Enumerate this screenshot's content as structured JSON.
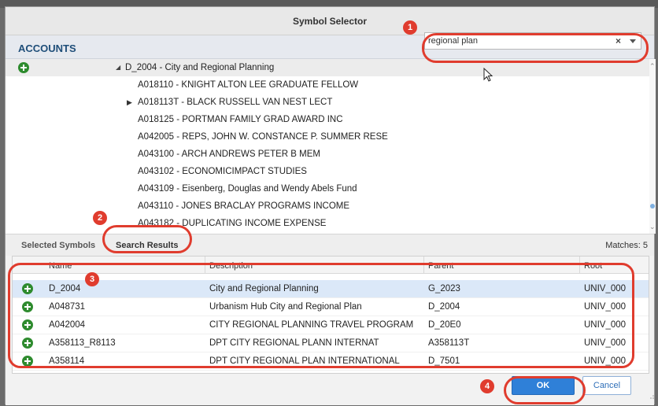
{
  "dialog": {
    "title": "Symbol Selector"
  },
  "accounts": {
    "label": "ACCOUNTS",
    "search": {
      "value": "regional plan",
      "clear": "×"
    }
  },
  "tree": {
    "root": {
      "label": "D_2004 - City and Regional Planning",
      "expanded": true
    },
    "items": [
      {
        "label": "A018110 - KNIGHT ALTON LEE GRADUATE FELLOW",
        "expandable": false
      },
      {
        "label": "A018113T - BLACK RUSSELL VAN NEST LECT",
        "expandable": true
      },
      {
        "label": "A018125 - PORTMAN FAMILY GRAD AWARD INC",
        "expandable": false
      },
      {
        "label": "A042005 - REPS, JOHN W. CONSTANCE P. SUMMER RESE",
        "expandable": false
      },
      {
        "label": "A043100 - ARCH ANDREWS PETER B MEM",
        "expandable": false
      },
      {
        "label": "A043102 - ECONOMICIMPACT STUDIES",
        "expandable": false
      },
      {
        "label": "A043109 - Eisenberg, Douglas and Wendy Abels Fund",
        "expandable": false
      },
      {
        "label": "A043110 - JONES BRACLAY PROGRAMS INCOME",
        "expandable": false
      },
      {
        "label": "A043182 - DUPLICATING INCOME EXPENSE",
        "expandable": false
      }
    ]
  },
  "tabs": [
    {
      "label": "Selected Symbols",
      "active": false
    },
    {
      "label": "Search Results",
      "active": true
    }
  ],
  "matches": "Matches: 5",
  "table": {
    "columns": [
      "Name",
      "Description",
      "Parent",
      "Root"
    ],
    "rows": [
      {
        "name": "D_2004",
        "description": "City and Regional Planning",
        "parent": "G_2023",
        "root": "UNIV_000"
      },
      {
        "name": "A048731",
        "description": "Urbanism Hub City and Regional Plan",
        "parent": "D_2004",
        "root": "UNIV_000"
      },
      {
        "name": "A042004",
        "description": "CITY REGIONAL PLANNING TRAVEL PROGRAM",
        "parent": "D_20E0",
        "root": "UNIV_000"
      },
      {
        "name": "A358113_R8113",
        "description": "DPT CITY REGIONAL PLANN INTERNAT",
        "parent": "A358113T",
        "root": "UNIV_000"
      },
      {
        "name": "A358114",
        "description": "DPT CITY REGIONAL PLAN INTERNATIONAL",
        "parent": "D_7501",
        "root": "UNIV_000"
      }
    ]
  },
  "buttons": {
    "ok": "OK",
    "cancel": "Cancel"
  },
  "callouts": [
    "1",
    "2",
    "3",
    "4"
  ],
  "colors": {
    "accent": "#2f80d8",
    "add": "#2e8b2e",
    "callout": "#e03c2e",
    "selected_row": "#dbe8f8"
  }
}
